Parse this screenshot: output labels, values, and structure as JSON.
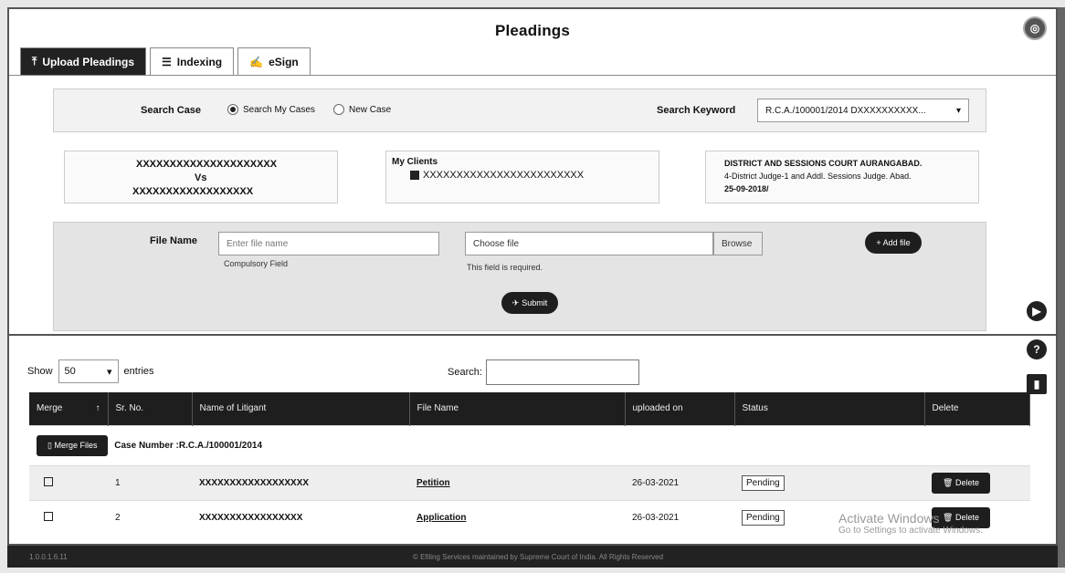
{
  "page": {
    "title": "Pleadings"
  },
  "tabs": [
    {
      "label": "Upload Pleadings",
      "icon": "upload-icon"
    },
    {
      "label": "Indexing",
      "icon": "list-icon"
    },
    {
      "label": "eSign",
      "icon": "user-sign-icon"
    }
  ],
  "search": {
    "label": "Search Case",
    "radio_my": "Search My Cases",
    "radio_new": "New Case",
    "keyword_label": "Search Keyword",
    "keyword_value": "R.C.A./100001/2014 DXXXXXXXXXX..."
  },
  "case": {
    "party1": "XXXXXXXXXXXXXXXXXXXXX",
    "vs": "Vs",
    "party2": "XXXXXXXXXXXXXXXXXX",
    "clients_label": "My Clients",
    "client_name": "XXXXXXXXXXXXXXXXXXXXXXXX",
    "court_name": "DISTRICT AND SESSIONS COURT AURANGABAD.",
    "court_detail": "4-District Judge-1 and Addl. Sessions Judge. Abad.",
    "court_date": "25-09-2018/"
  },
  "upload": {
    "file_name_label": "File Name",
    "file_name_placeholder": "Enter file name",
    "file_name_hint": "Compulsory Field",
    "choose_file_label": "Choose file",
    "browse_label": "Browse",
    "file_hint": "This field is required.",
    "add_file_label": "+ Add file",
    "submit_label": "Submit"
  },
  "table_controls": {
    "show_label": "Show",
    "entries_value": "50",
    "entries_label": "entries",
    "search_label": "Search:"
  },
  "table": {
    "headers": [
      "Merge",
      "Sr. No.",
      "Name of Litigant",
      "File Name",
      "uploaded on",
      "Status",
      "Delete"
    ],
    "merge_files_label": "Merge Files",
    "case_number": "Case Number :R.C.A./100001/2014",
    "rows": [
      {
        "sr": "1",
        "litigant": "XXXXXXXXXXXXXXXXXX",
        "file": "Petition",
        "uploaded": "26-03-2021",
        "status": "Pending",
        "delete": "Delete"
      },
      {
        "sr": "2",
        "litigant": "XXXXXXXXXXXXXXXXX",
        "file": "Application",
        "uploaded": "26-03-2021",
        "status": "Pending",
        "delete": "Delete"
      }
    ]
  },
  "footer": {
    "left": "1.0.0.1.6.11",
    "text": "© Efiling Services maintained by Supreme Court of India. All Rights Reserved"
  },
  "watermark": {
    "line1": "Activate Windows",
    "line2": "Go to Settings to activate Windows."
  }
}
